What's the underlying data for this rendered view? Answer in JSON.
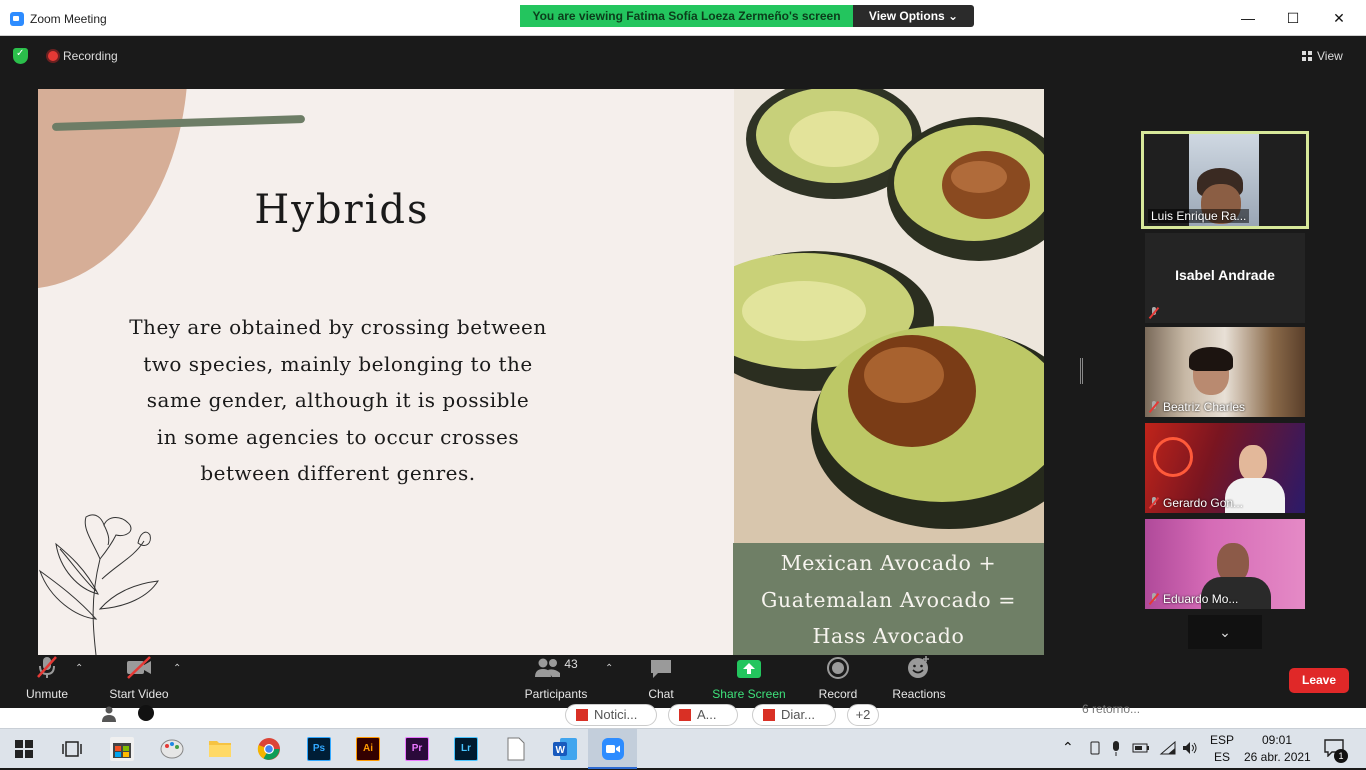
{
  "window": {
    "title": "Zoom Meeting"
  },
  "banner": {
    "text": "You are viewing Fatima Sofía Loeza Zermeño's screen",
    "view_options": "View Options ⌄"
  },
  "window_controls": {
    "minimize": "—",
    "maximize": "☐",
    "close": "✕"
  },
  "top": {
    "recording": "Recording",
    "view": "View"
  },
  "slide": {
    "title": "Hybrids",
    "body_lines": [
      "They are obtained by crossing between",
      "two species, mainly belonging to the",
      "same gender, although it is possible",
      "in some agencies to occur crosses",
      "between different genres."
    ],
    "caption_lines": [
      "Mexican Avocado +",
      "Guatemalan Avocado =",
      "Hass Avocado"
    ]
  },
  "participants": [
    {
      "name": "Luis Enrique Ra...",
      "active": true
    },
    {
      "name": "Isabel Andrade",
      "video": false
    },
    {
      "name": "Beatriz Charles"
    },
    {
      "name": "Gerardo Gon..."
    },
    {
      "name": "Eduardo Mo..."
    }
  ],
  "more_chevron": "⌄",
  "toolbar": {
    "unmute": "Unmute",
    "start_video": "Start Video",
    "participants": "Participants",
    "participant_count": "43",
    "chat": "Chat",
    "share_screen": "Share Screen",
    "record": "Record",
    "reactions": "Reactions",
    "leave": "Leave",
    "caret": "⌃"
  },
  "background_strip": {
    "chips": [
      "Notici...",
      "A...",
      "Diar...",
      "+2"
    ],
    "right_text": "6 retorno..."
  },
  "taskbar": {
    "apps": [
      "start",
      "task-view",
      "store",
      "paint",
      "file-explorer",
      "chrome",
      "Ps",
      "Ai",
      "Pr",
      "Lr",
      "notepad",
      "word",
      "zoom"
    ],
    "ps": "Ps",
    "ai": "Ai",
    "pr": "Pr",
    "lr": "Lr",
    "lang_top": "ESP",
    "lang_bottom": "ES",
    "time": "09:01",
    "date": "26 abr. 2021",
    "notification_count": "1"
  },
  "colors": {
    "banner_green": "#23c55e",
    "slide_bg": "#f5efec",
    "caption_green": "#6f7f66",
    "active_border": "#d7e89a",
    "share_green": "#23c55e",
    "leave_red": "#e02828"
  }
}
